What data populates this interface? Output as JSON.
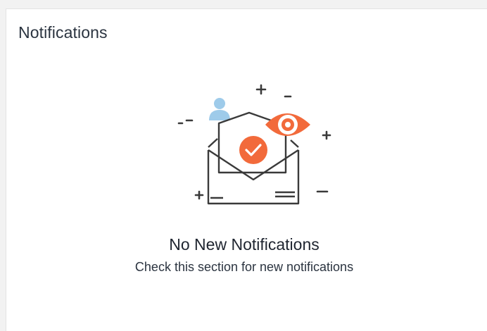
{
  "panel": {
    "title": "Notifications"
  },
  "empty_state": {
    "title": "No New Notifications",
    "subtitle": "Check this section for new notifications",
    "illustration_icon": "envelope-with-check-eye-user-icon"
  },
  "colors": {
    "accent": "#f26a3b",
    "user": "#9ecbea",
    "line": "#3a3a3a",
    "text": "#1f2530"
  }
}
